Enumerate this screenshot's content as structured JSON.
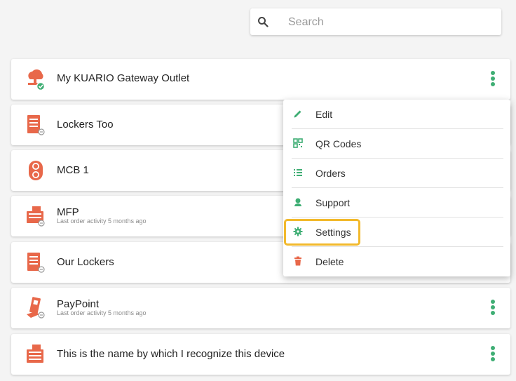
{
  "search": {
    "placeholder": "Search",
    "icon": "search-icon"
  },
  "devices": [
    {
      "name": "My KUARIO Gateway Outlet",
      "subtitle": "",
      "icon": "gateway-cloud-icon"
    },
    {
      "name": "Lockers Too",
      "subtitle": "",
      "icon": "locker-icon"
    },
    {
      "name": "MCB 1",
      "subtitle": "",
      "icon": "mcb-icon"
    },
    {
      "name": "MFP",
      "subtitle": "Last order activity 5 months ago",
      "icon": "printer-icon"
    },
    {
      "name": "Our Lockers",
      "subtitle": "",
      "icon": "locker-icon"
    },
    {
      "name": "PayPoint",
      "subtitle": "Last order activity 5 months ago",
      "icon": "paypoint-icon"
    },
    {
      "name": "This is the name by which I recognize this device",
      "subtitle": "",
      "icon": "printer-icon"
    }
  ],
  "context_menu": {
    "items": [
      {
        "label": "Edit",
        "icon": "pencil-icon"
      },
      {
        "label": "QR Codes",
        "icon": "qr-code-icon"
      },
      {
        "label": "Orders",
        "icon": "list-icon"
      },
      {
        "label": "Support",
        "icon": "support-agent-icon"
      },
      {
        "label": "Settings",
        "icon": "gear-icon",
        "highlighted": true
      },
      {
        "label": "Delete",
        "icon": "trash-icon"
      }
    ]
  },
  "colors": {
    "device_icon": "#e8684a",
    "accent_green": "#3fae74",
    "highlight": "#f2b92c",
    "delete": "#e8684a"
  }
}
